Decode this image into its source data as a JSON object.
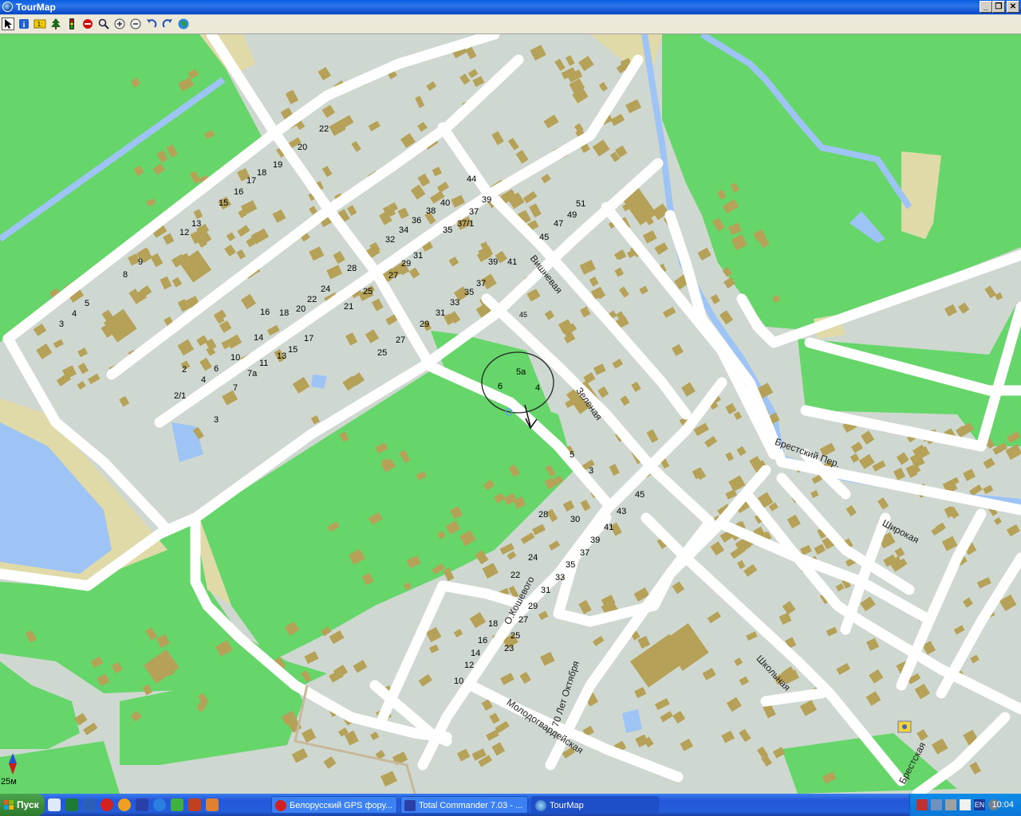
{
  "window": {
    "title": "TourMap"
  },
  "toolbar": {
    "tools": [
      "pointer-tool",
      "info-tool",
      "scale-tool",
      "tree-tool",
      "traffic-tool",
      "stop-tool",
      "search-tool",
      "zoom-in-tool",
      "zoom-out-tool",
      "undo-tool",
      "redo-tool",
      "globe-tool"
    ],
    "scale_icon_text": "1:"
  },
  "map": {
    "scale_text": "25м",
    "streets": [
      "Вишневая",
      "Зеленая",
      "Брестский Пер.",
      "Широкая",
      "О.Кошевого",
      "70 Лет Октября",
      "Молодогвардейская",
      "Школьная",
      "Брестская"
    ],
    "house_numbers": [
      "22",
      "20",
      "19",
      "18",
      "17",
      "16",
      "15",
      "13",
      "12",
      "9",
      "8",
      "5",
      "4",
      "3",
      "28",
      "24",
      "22",
      "21",
      "20",
      "18",
      "16",
      "14",
      "17",
      "15",
      "13",
      "11",
      "10",
      "6",
      "4",
      "2",
      "7а",
      "7",
      "2/1",
      "3",
      "25",
      "27",
      "25",
      "29",
      "27",
      "31",
      "29",
      "32",
      "34",
      "36",
      "38",
      "40",
      "44",
      "39",
      "37",
      "37/1",
      "35",
      "31",
      "33",
      "35",
      "37",
      "39",
      "41",
      "45",
      "47",
      "49",
      "51",
      "45",
      "5а",
      "6",
      "4",
      "5",
      "3",
      "45",
      "43",
      "41",
      "39",
      "37",
      "35",
      "33",
      "31",
      "29",
      "27",
      "25",
      "23",
      "24",
      "22",
      "30",
      "28",
      "18",
      "16",
      "14",
      "12",
      "10"
    ],
    "colors": {
      "land": "#cfd8d0",
      "park": "#66d66a",
      "water": "#9ec3f5",
      "building": "#b5a157",
      "road": "#ffffff",
      "sand": "#e0d9a8"
    }
  },
  "taskbar": {
    "start_label": "Пуск",
    "tasks": [
      {
        "label": "Белорусский GPS фору...",
        "icon": "opera-icon",
        "active": false
      },
      {
        "label": "Total Commander 7.03 - ...",
        "icon": "floppy-icon",
        "active": false
      },
      {
        "label": "TourMap",
        "icon": "globe-icon",
        "active": true
      }
    ],
    "lang": "EN",
    "clock": "10:04"
  }
}
